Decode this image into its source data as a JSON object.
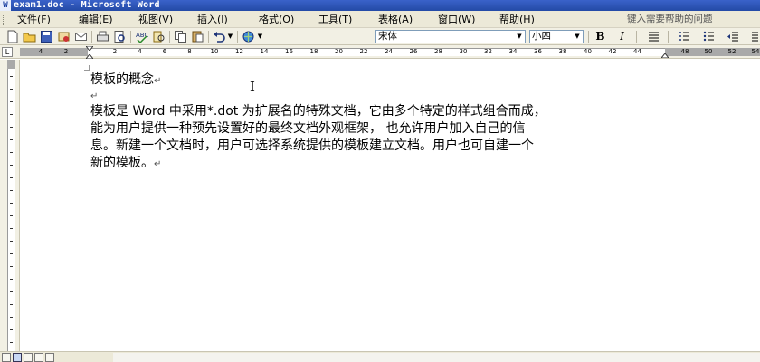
{
  "window": {
    "title": "exam1.doc - Microsoft Word",
    "app_icon": "word-icon"
  },
  "menu": {
    "items": [
      "文件(F)",
      "编辑(E)",
      "视图(V)",
      "插入(I)",
      "格式(O)",
      "工具(T)",
      "表格(A)",
      "窗口(W)",
      "帮助(H)"
    ],
    "help_placeholder": "键入需要帮助的问题"
  },
  "toolbar": {
    "icons": [
      "new-doc-icon",
      "open-folder-icon",
      "save-icon",
      "permission-icon",
      "email-icon",
      "print-icon",
      "print-preview-icon",
      "spelling-icon",
      "research-icon",
      "copy-icon",
      "paste-icon",
      "undo-icon",
      "dropdown-arrow-icon",
      "hyperlink-icon",
      "dropdown-arrow-icon"
    ],
    "font_name": "宋体",
    "font_size": "小四",
    "bold_label": "B",
    "italic_label": "I"
  },
  "ruler": {
    "tab_selector": "L",
    "ticks": [
      "4",
      "2",
      "2",
      "4",
      "6",
      "8",
      "10",
      "12",
      "14",
      "16",
      "18",
      "20",
      "22",
      "24",
      "26",
      "28",
      "30",
      "32",
      "34",
      "36",
      "38",
      "40",
      "42",
      "44",
      "48",
      "50",
      "52",
      "54"
    ]
  },
  "document": {
    "lines": [
      "模板的概念",
      "",
      "模板是 Word 中采用*.dot 为扩展名的特殊文档，它由多个特定的样式组合而成，",
      "能为用户提供一种预先设置好的最终文档外观框架，  也允许用户加入自己的信",
      "息。新建一个文档时，用户可选择系统提供的模板建立文档。用户也可自建一个",
      "新的模板。"
    ],
    "paragraph_mark": "↵",
    "cursor": "I"
  },
  "colors": {
    "titlebar": "#234aa6",
    "chrome": "#ece9d8",
    "ruler_gray": "#a9a9a9"
  }
}
